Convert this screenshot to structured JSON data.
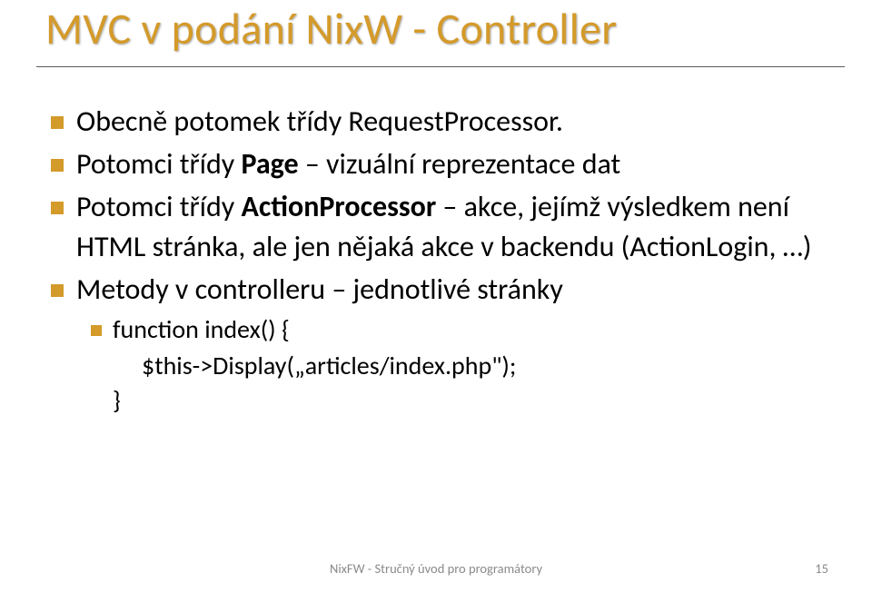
{
  "title": "MVC v podání NixW - Controller",
  "bullets": {
    "b1": "Obecně potomek třídy RequestProcessor.",
    "b2_prefix": "Potomci třídy ",
    "b2_bold": "Page",
    "b2_suffix": " – vizuální reprezentace dat",
    "b2_cont": "dat",
    "b3_prefix": "Potomci třídy ",
    "b3_bold": "ActionProcessor",
    "b3_suffix": " – akce, jejímž výsledkem není HTML stránka, ale jen nějaká akce v backendu (ActionLogin, …)",
    "b4": "Metody v controlleru – jednotlivé stránky",
    "b4_sub1": "function index() {",
    "b4_sub1_body": "$this->Display(„articles/index.php\");",
    "b4_sub1_close": "}"
  },
  "footer": "NixFW - Stručný úvod pro programátory",
  "page": "15"
}
